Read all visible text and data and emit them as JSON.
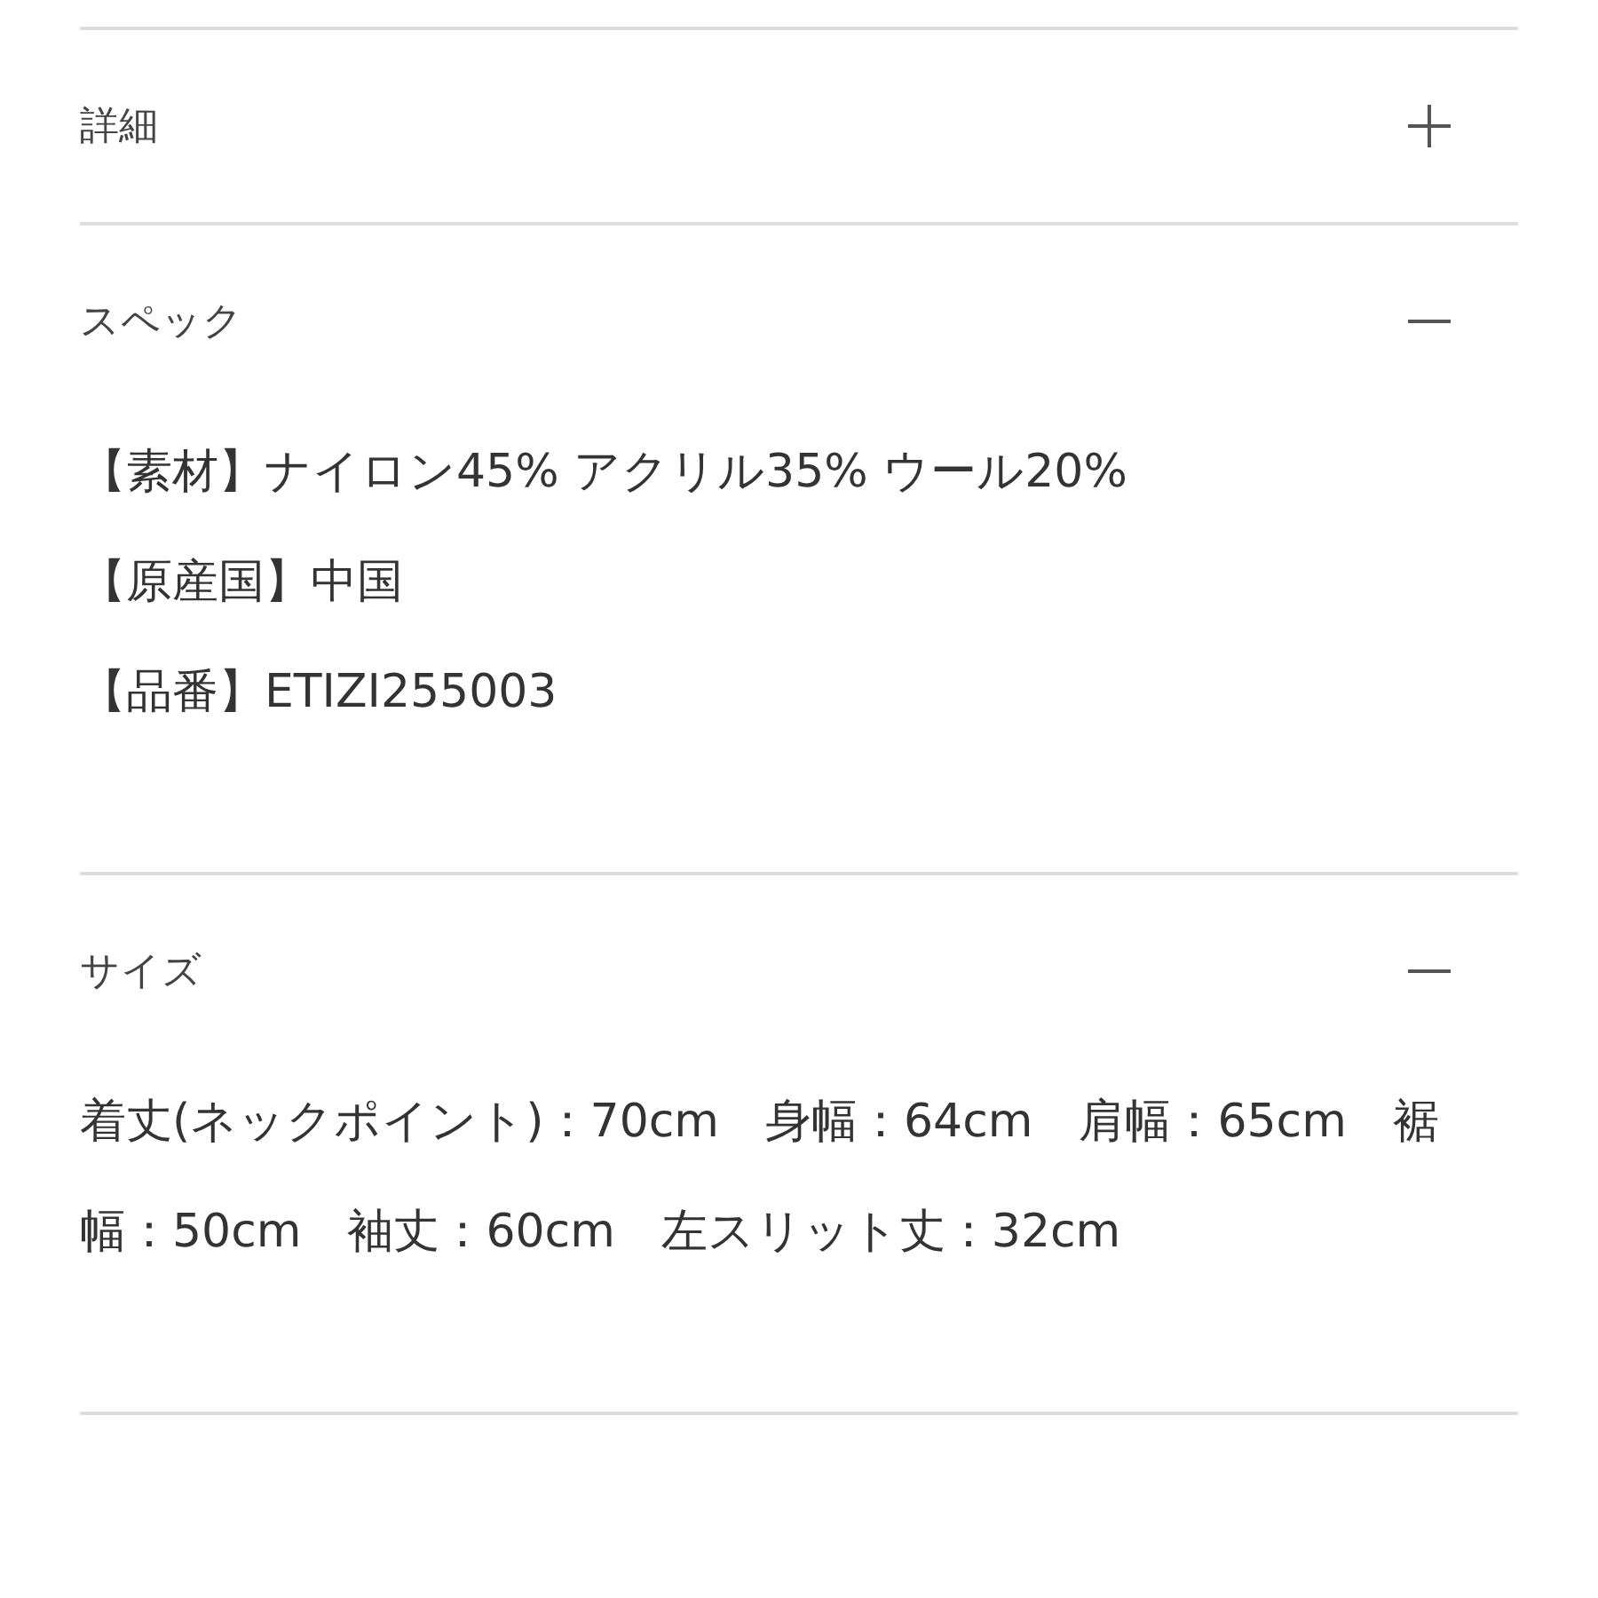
{
  "sections": [
    {
      "title": "詳細",
      "expanded": false
    },
    {
      "title": "スペック",
      "expanded": true,
      "lines": [
        "【素材】ナイロン45% アクリル35% ウール20%",
        "【原産国】中国",
        "【品番】ETIZI255003"
      ]
    },
    {
      "title": "サイズ",
      "expanded": true,
      "lines": [
        "着丈(ネックポイント)：70cm　身幅：64cm　肩幅：65cm　裾幅：50cm　袖丈：60cm　左スリット丈：32cm"
      ]
    }
  ]
}
